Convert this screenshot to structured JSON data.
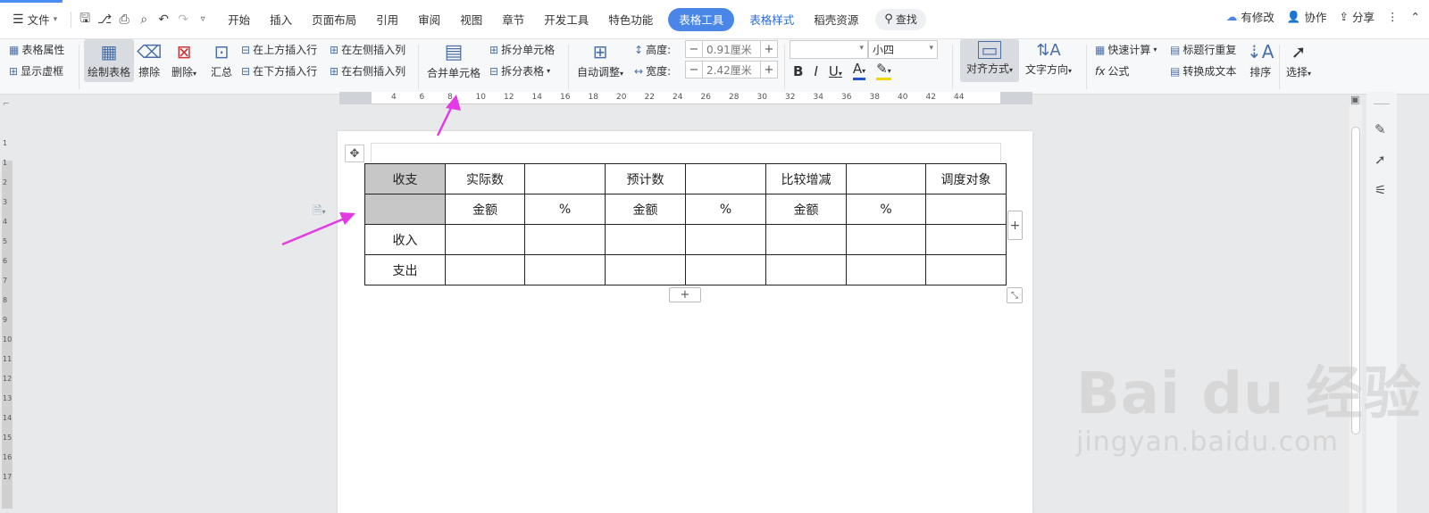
{
  "menubar": {
    "file_label": "文件",
    "tabs": [
      "开始",
      "插入",
      "页面布局",
      "引用",
      "审阅",
      "视图",
      "章节",
      "开发工具",
      "特色功能"
    ],
    "active_tab": "表格工具",
    "style_tab": "表格样式",
    "resource_tab": "稻壳资源",
    "search_label": "查找",
    "right": {
      "modify": "有修改",
      "collab": "协作",
      "share": "分享"
    }
  },
  "ribbon": {
    "table_props": "表格属性",
    "show_gridlines": "显示虚框",
    "draw_table": "绘制表格",
    "erase": "擦除",
    "delete": "删除",
    "summary": "汇总",
    "insert_above": "在上方插入行",
    "insert_below": "在下方插入行",
    "insert_left": "在左侧插入列",
    "insert_right": "在右侧插入列",
    "merge_cells": "合并单元格",
    "split_cells": "拆分单元格",
    "split_table": "拆分表格",
    "auto_fit": "自动调整",
    "height_label": "高度:",
    "height_value": "0.91厘米",
    "width_label": "宽度:",
    "width_value": "2.42厘米",
    "font_name": "",
    "font_size": "小四",
    "align": "对齐方式",
    "text_dir": "文字方向",
    "quick_calc": "快速计算",
    "formula": "公式",
    "repeat_header": "标题行重复",
    "to_text": "转换成文本",
    "sort": "排序",
    "select": "选择"
  },
  "ruler": {
    "h": [
      "4",
      "6",
      "8",
      "10",
      "12",
      "14",
      "16",
      "18",
      "20",
      "22",
      "24",
      "26",
      "28",
      "30",
      "32",
      "34",
      "36",
      "38",
      "40",
      "42",
      "44"
    ],
    "v": [
      "1",
      "1",
      "2",
      "3",
      "4",
      "5",
      "6",
      "7",
      "8",
      "9",
      "10",
      "11",
      "12",
      "13",
      "14",
      "15",
      "16",
      "17"
    ]
  },
  "table": {
    "rows": [
      [
        "收支",
        "实际数",
        "",
        "预计数",
        "",
        "比较增减",
        "",
        "调度对象"
      ],
      [
        "",
        "金额",
        "%",
        "金额",
        "%",
        "金额",
        "%",
        ""
      ],
      [
        "收入",
        "",
        "",
        "",
        "",
        "",
        "",
        ""
      ],
      [
        "支出",
        "",
        "",
        "",
        "",
        "",
        "",
        ""
      ]
    ]
  },
  "watermark": {
    "brand": "Bai du 经验",
    "url": "jingyan.baidu.com"
  },
  "colors": {
    "accent": "#4a86e8",
    "arrow": "#e23be3",
    "header_cell": "#c7c7c7"
  }
}
